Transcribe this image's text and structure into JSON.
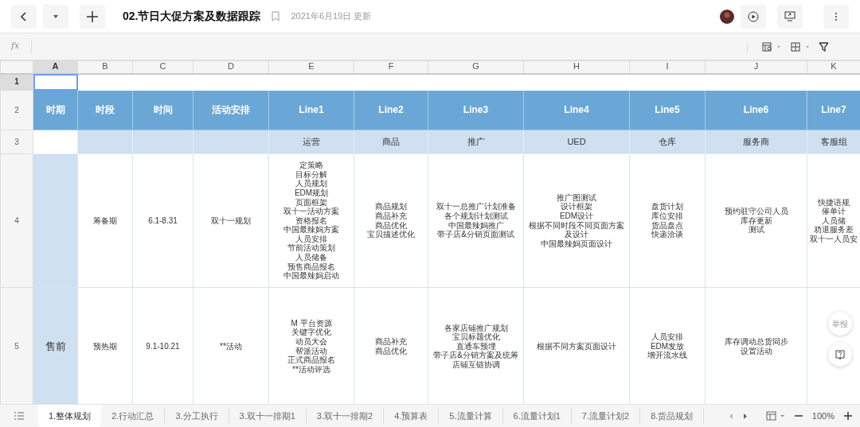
{
  "header": {
    "title": "02.节日大促方案及数据跟踪",
    "updated": "2021年6月19日 更新"
  },
  "formula_bar": {
    "label": "fx"
  },
  "grid": {
    "columns": [
      {
        "label": "A",
        "selected": true
      },
      {
        "label": "B",
        "selected": false
      },
      {
        "label": "C",
        "selected": false
      },
      {
        "label": "D",
        "selected": false
      },
      {
        "label": "E",
        "selected": false
      },
      {
        "label": "F",
        "selected": false
      },
      {
        "label": "G",
        "selected": false
      },
      {
        "label": "H",
        "selected": false
      },
      {
        "label": "I",
        "selected": false
      },
      {
        "label": "J",
        "selected": false
      },
      {
        "label": "K",
        "selected": false
      }
    ],
    "rows": [
      {
        "number": "1",
        "selected": true,
        "kind": "blank",
        "cells": []
      },
      {
        "number": "2",
        "selected": false,
        "kind": "header",
        "cells": [
          "时期",
          "时段",
          "时间",
          "活动安排",
          "Line1",
          "Line2",
          "Line3",
          "Line4",
          "Line5",
          "Line6",
          "Line7"
        ]
      },
      {
        "number": "3",
        "selected": false,
        "kind": "subheader",
        "cells": [
          "",
          "",
          "",
          "",
          "运营",
          "商品",
          "推广",
          "UED",
          "仓库",
          "服务商",
          "客服组"
        ]
      },
      {
        "number": "4",
        "selected": false,
        "kind": "body",
        "cells": [
          [],
          [
            "筹备期"
          ],
          [
            "6.1-8.31"
          ],
          [
            "双十一规划"
          ],
          [
            "定策略",
            "目标分解",
            "人员规划",
            "EDM规划",
            "页面框架",
            "双十一活动方案",
            "资格报名",
            "中国最辣妈方案",
            "人员安排",
            "节前活动策划",
            "人员储备",
            "预售商品报名",
            "中国最辣妈启动"
          ],
          [
            "商品规划",
            "商品补充",
            "商品优化",
            "宝贝描述优化"
          ],
          [
            "双十一总推广计划准备",
            "各个规划计划测试",
            "中国最辣妈推广",
            "带子店&分销页面测试"
          ],
          [
            "推广图测试",
            "设计框架",
            "EDM设计",
            "根据不同时段不同页面方案",
            "及设计",
            "中国最辣妈页面设计"
          ],
          [
            "盘货计划",
            "库位安排",
            "货品盘点",
            "快递洽谈"
          ],
          [
            "预约驻守公司人员",
            "库存更新",
            "测试"
          ],
          [
            "快捷语规",
            "催单计",
            "人员储",
            "劝退服务差",
            "双十一人员安"
          ]
        ]
      },
      {
        "number": "5",
        "selected": false,
        "kind": "body",
        "cells": [
          [
            "售前"
          ],
          [
            "预热期"
          ],
          [
            "9.1-10.21"
          ],
          [
            "**活动"
          ],
          [
            "M 平台资源",
            "关键字优化",
            "动员大会",
            "帮派活动",
            "正式商品报名",
            "**活动评选"
          ],
          [
            "商品补充",
            "商品优化"
          ],
          [
            "各家店铺推广规划",
            "宝贝标题优化",
            "直通车预埋",
            "带子店&分销方案及统筹",
            "店铺互链协调"
          ],
          [
            "根据不同方案页面设计"
          ],
          [
            "人员安排",
            "EDM发放",
            "增开流水线"
          ],
          [
            "库存调动总货同步",
            "设置活动"
          ],
          []
        ]
      }
    ]
  },
  "float_buttons": {
    "report": "举报"
  },
  "sheet_tabs": [
    {
      "label": "1.整体规划",
      "selected": true
    },
    {
      "label": "2.行动汇总",
      "selected": false
    },
    {
      "label": "3.分工执行",
      "selected": false
    },
    {
      "label": "3.双十一排期1",
      "selected": false
    },
    {
      "label": "3.双十一排期2",
      "selected": false
    },
    {
      "label": "4.预算表",
      "selected": false
    },
    {
      "label": "5.流量计算",
      "selected": false
    },
    {
      "label": "6.流量计划1",
      "selected": false
    },
    {
      "label": "7.流量计划2",
      "selected": false
    },
    {
      "label": "8.货品规划",
      "selected": false
    }
  ],
  "zoom": "100%"
}
